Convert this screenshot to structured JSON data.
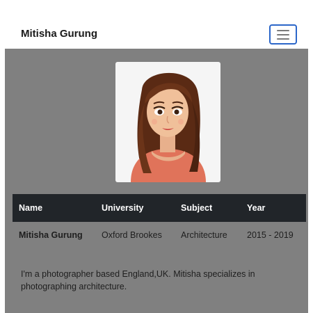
{
  "navbar": {
    "brand": "Mitisha Gurung",
    "toggle_icon": "hamburger-menu-icon",
    "toggle_border_color": "#2b66c9"
  },
  "profile": {
    "avatar_icon": "cartoon-woman-avatar",
    "table": {
      "headers": [
        "Name",
        "University",
        "Subject",
        "Year"
      ],
      "row": [
        "Mitisha Gurung",
        "Oxford Brookes",
        "Architecture",
        "2015 - 2019"
      ]
    },
    "bio": "I'm a photographer based England,UK. Mitisha specializes in photographing architecture."
  },
  "colors": {
    "page_background": "#808080",
    "table_header": "#212529"
  }
}
